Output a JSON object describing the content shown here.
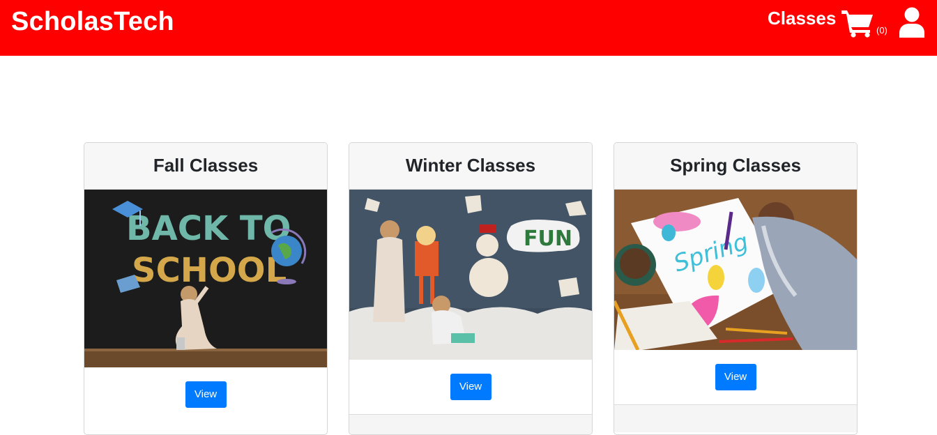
{
  "header": {
    "brand": "ScholasTech",
    "classes_link": "Classes",
    "cart_count": "(0)",
    "icons": [
      "cart-icon",
      "user-icon"
    ]
  },
  "colors": {
    "header": "#ff0000",
    "button": "#007bff",
    "card_header": "#f7f7f7"
  },
  "cards": [
    {
      "title": "Fall Classes",
      "image": "back-to-school-chalkboard-photo",
      "image_text": [
        "BACK TO",
        "SCHOOL"
      ],
      "button": "View"
    },
    {
      "title": "Winter Classes",
      "image": "kids-snowman-fun-paper-craft-photo",
      "image_text": [
        "FUN"
      ],
      "button": "View"
    },
    {
      "title": "Spring Classes",
      "image": "child-drawing-spring-poster-photo",
      "image_text": [
        "Spring"
      ],
      "button": "View"
    }
  ]
}
